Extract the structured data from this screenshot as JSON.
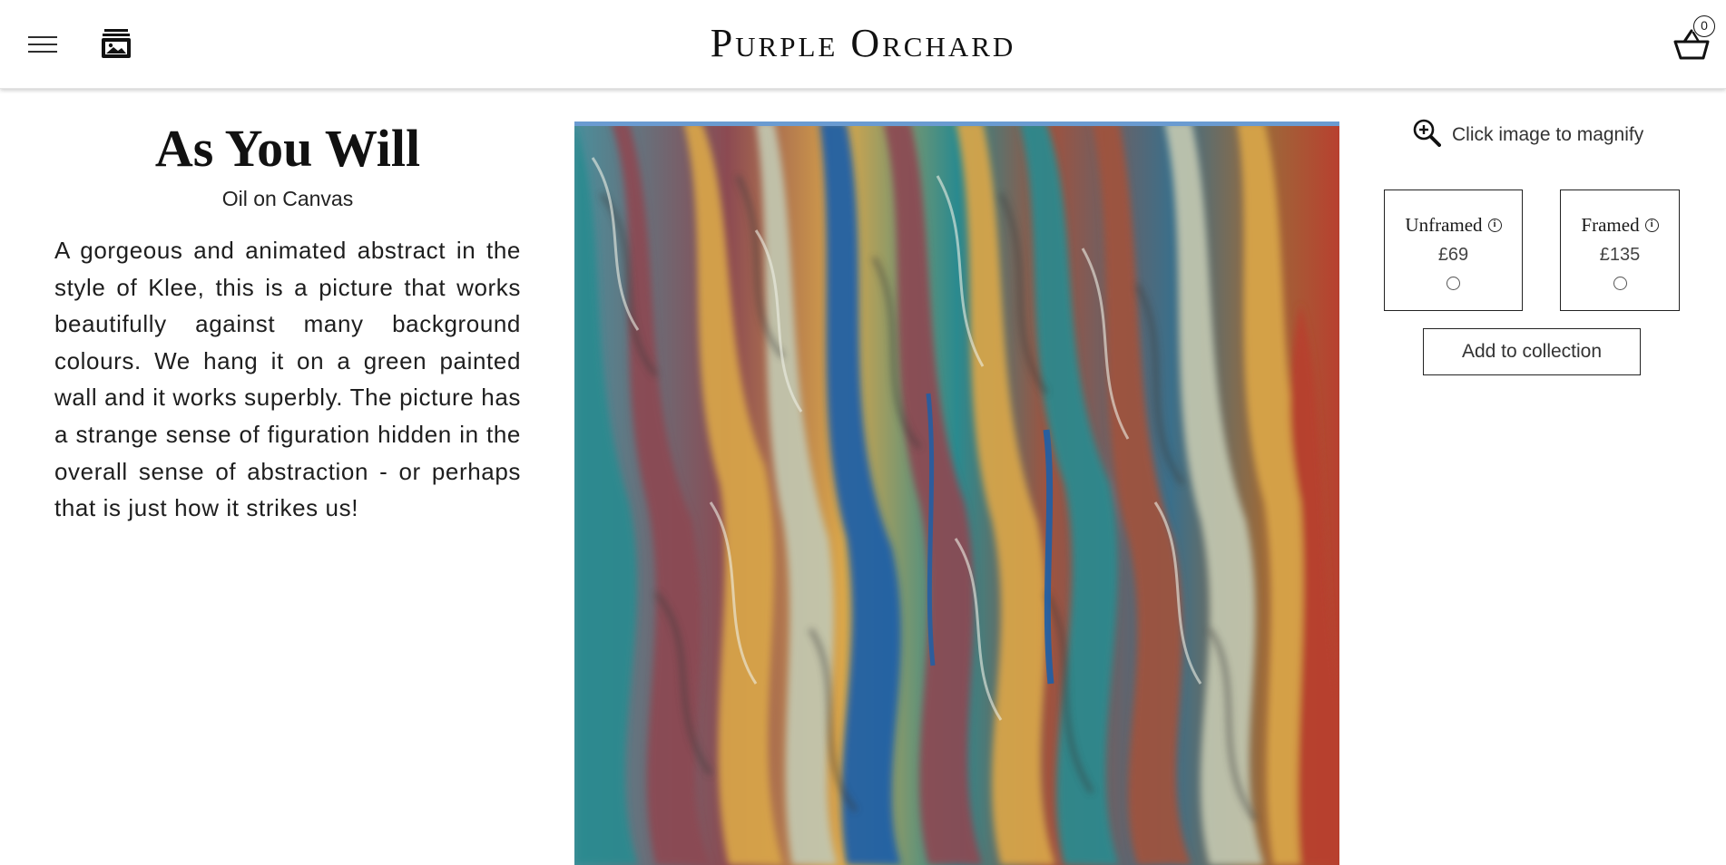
{
  "header": {
    "brand": "Purple Orchard",
    "menu_icon": "hamburger-menu-icon",
    "gallery_icon": "gallery-icon",
    "cart_icon": "basket-icon",
    "cart_count": "0"
  },
  "artwork": {
    "title": "As You Will",
    "medium": "Oil on Canvas",
    "description": "A gorgeous and animated abstract in the style of Klee, this is a picture that works beautifully against many background colours. We hang it on a green painted wall and it works superbly. The picture has a strange sense of figuration hidden in the overall sense of abstraction - or perhaps that is just how it strikes us!"
  },
  "magnify": {
    "icon": "magnify-plus-icon",
    "label": "Click image to magnify"
  },
  "options": [
    {
      "name": "Unframed",
      "price": "£69",
      "selected": false
    },
    {
      "name": "Framed",
      "price": "£135",
      "selected": false
    }
  ],
  "actions": {
    "add_label": "Add to collection"
  },
  "colors": {
    "text": "#111111",
    "border": "#222222",
    "painting_palette": [
      "#8c4a52",
      "#d9a64a",
      "#2a8a8f",
      "#1d5fa8",
      "#3a3a3a",
      "#c2c7b0",
      "#b8402f"
    ]
  }
}
